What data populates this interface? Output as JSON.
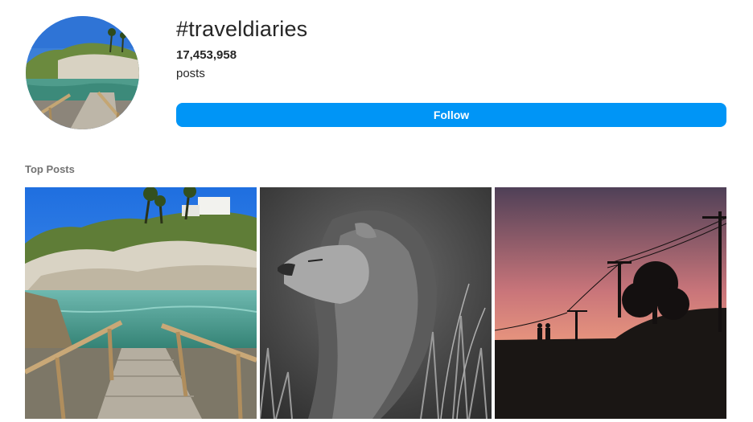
{
  "hashtag": {
    "title": "#traveldiaries",
    "post_count": "17,453,958",
    "post_label": "posts",
    "follow_label": "Follow"
  },
  "top_posts": {
    "title": "Top Posts",
    "items": [
      {
        "subject": "coastal cove with wooden stairs and palm trees"
      },
      {
        "subject": "black and white lion in tall grass"
      },
      {
        "subject": "sunset silhouette of couple with power lines and tree"
      }
    ]
  },
  "colors": {
    "accent": "#0095f6",
    "primary_text": "#262626",
    "secondary_text": "#737373"
  }
}
